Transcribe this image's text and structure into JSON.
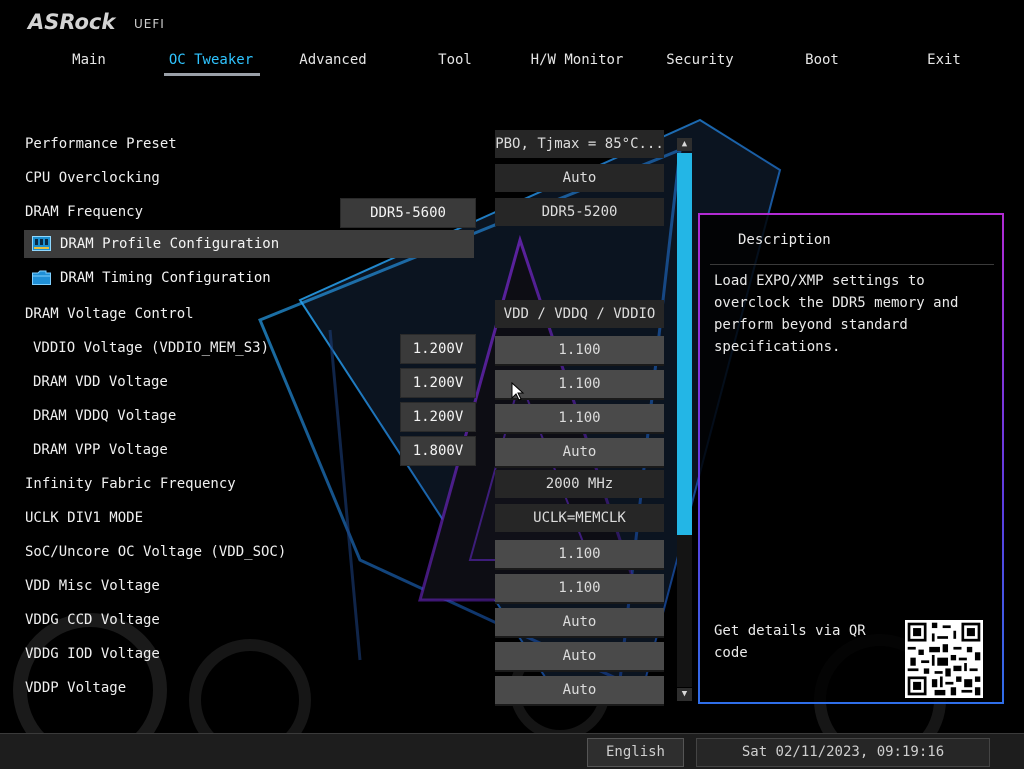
{
  "brand": {
    "logo": "ASRock",
    "suffix": "UEFI"
  },
  "tabs": [
    {
      "label": "Main",
      "active": false
    },
    {
      "label": "OC Tweaker",
      "active": true
    },
    {
      "label": "Advanced",
      "active": false
    },
    {
      "label": "Tool",
      "active": false
    },
    {
      "label": "H/W Monitor",
      "active": false
    },
    {
      "label": "Security",
      "active": false
    },
    {
      "label": "Boot",
      "active": false
    },
    {
      "label": "Exit",
      "active": false
    }
  ],
  "settings": [
    {
      "label": "Performance Preset",
      "current": "",
      "value": "PBO, Tjmax = 85°C..."
    },
    {
      "label": "CPU Overclocking",
      "current": "",
      "value": "Auto"
    },
    {
      "label": "DRAM Frequency",
      "current": "DDR5-5600",
      "value": "DDR5-5200"
    },
    {
      "label": "DRAM Profile Configuration",
      "current": "",
      "value": "",
      "submenu": true,
      "selected": true,
      "icon": "memory-module-icon"
    },
    {
      "label": "DRAM Timing Configuration",
      "current": "",
      "value": "",
      "submenu": true,
      "icon": "folder-icon"
    },
    {
      "label": "DRAM Voltage Control",
      "current": "",
      "value": "VDD / VDDQ / VDDIO"
    },
    {
      "label": "VDDIO Voltage (VDDIO_MEM_S3)",
      "current": "1.200V",
      "value": "1.100"
    },
    {
      "label": "DRAM VDD Voltage",
      "current": "1.200V",
      "value": "1.100"
    },
    {
      "label": "DRAM VDDQ Voltage",
      "current": "1.200V",
      "value": "1.100"
    },
    {
      "label": "DRAM VPP Voltage",
      "current": "1.800V",
      "value": "Auto"
    },
    {
      "label": "Infinity Fabric Frequency",
      "current": "",
      "value": "2000 MHz"
    },
    {
      "label": "UCLK DIV1 MODE",
      "current": "",
      "value": "UCLK=MEMCLK"
    },
    {
      "label": "SoC/Uncore OC Voltage (VDD_SOC)",
      "current": "",
      "value": "1.100"
    },
    {
      "label": "VDD Misc Voltage",
      "current": "",
      "value": "1.100"
    },
    {
      "label": "VDDG CCD Voltage",
      "current": "",
      "value": "Auto"
    },
    {
      "label": "VDDG IOD Voltage",
      "current": "",
      "value": "Auto"
    },
    {
      "label": "VDDP Voltage",
      "current": "",
      "value": "Auto"
    }
  ],
  "description": {
    "title": "Description",
    "text": "Load EXPO/XMP settings to overclock the DDR5 memory and perform beyond standard specifications.",
    "qr_label": "Get details via QR code"
  },
  "scrollbar": {
    "up": "▲",
    "down": "▼"
  },
  "footer": {
    "language": "English",
    "datetime": "Sat 02/11/2023, 09:19:16"
  },
  "colors": {
    "accent": "#2fc4ff",
    "scrollbar": "#23b6e6",
    "panel_border_top": "#b12bd3",
    "panel_border_bottom": "#2f6ee8"
  }
}
